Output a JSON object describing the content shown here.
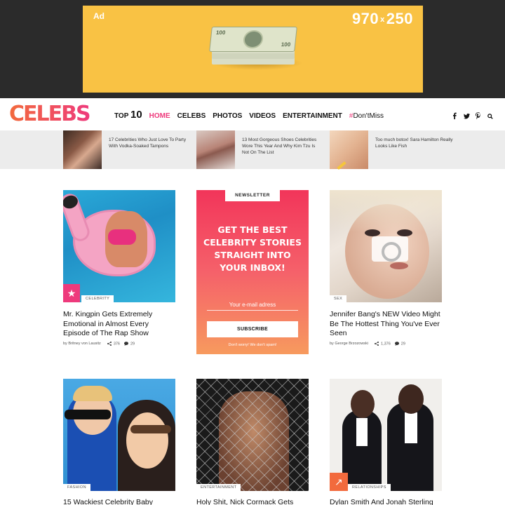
{
  "ad": {
    "label": "Ad",
    "size_w": "970",
    "size_x": "x",
    "size_h": "250",
    "background": "#f9c244"
  },
  "header": {
    "logo": "CELEBS",
    "nav": [
      {
        "prefix": "TOP",
        "big": "10",
        "label": "",
        "active": false
      },
      {
        "label": "HOME",
        "active": true
      },
      {
        "label": "CELEBS",
        "active": false
      },
      {
        "label": "PHOTOS",
        "active": false
      },
      {
        "label": "VIDEOS",
        "active": false
      },
      {
        "label": "ENTERTAINMENT",
        "active": false
      }
    ],
    "hashtag_symbol": "#",
    "hashtag_text": "Don'tMiss",
    "social": [
      "facebook-icon",
      "twitter-icon",
      "pinterest-icon",
      "search-icon"
    ],
    "accent": "#ee3a7c"
  },
  "trending": [
    {
      "title": "17 Celebrities Who Just Love To Party With Vodka-Soaked Tampons"
    },
    {
      "title": "13 Most Gorgeous Shoes Celebrities Wore This Year And Why Kim Tzu Is Not On The List"
    },
    {
      "title": "Too much botox! Sara Hamilton Really Looks Like Fish"
    }
  ],
  "cards": {
    "c1": {
      "category": "CELEBRITY",
      "title": "Mr. Kingpin Gets Extremely Emotional in Almost Every Episode of The Rap Show",
      "author": "by Britney von Lausitz",
      "shares": "376",
      "comments": "29"
    },
    "c3": {
      "category": "SEX",
      "title": "Jennifer Bang's NEW Video Might Be The Hottest Thing You've Ever Seen",
      "author": "by George Brzozowski",
      "shares": "1,376",
      "comments": "29"
    },
    "c4": {
      "category": "FASHION",
      "title": "15 Wackiest Celebrity Baby"
    },
    "c5": {
      "category": "ENTERTAINMENT",
      "title": "Holy Shit, Nick Cormack Gets"
    },
    "c6": {
      "category": "RELATIONSHIPS",
      "title": "Dylan Smith And Jonah Sterling"
    }
  },
  "newsletter": {
    "tab": "NEWSLETTER",
    "headline": "GET THE BEST CELEBRITY STORIES STRAIGHT INTO YOUR INBOX!",
    "placeholder": "Your e-mail adress",
    "button": "SUBSCRIBE",
    "note": "Don't worry! We don't spam!"
  }
}
